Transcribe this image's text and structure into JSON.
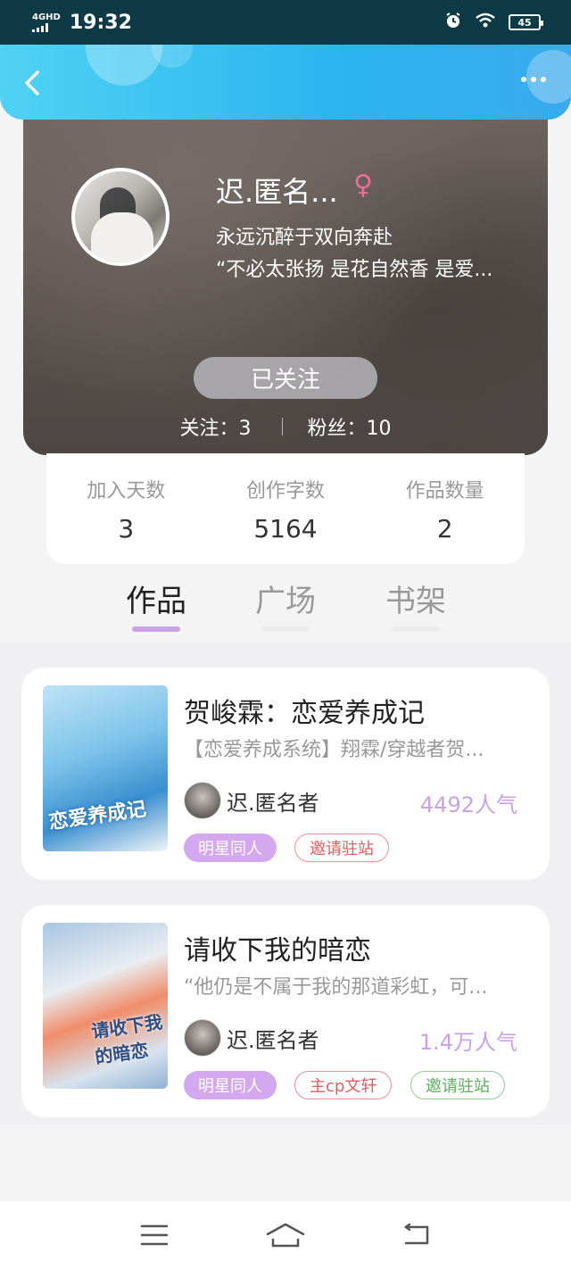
{
  "status_bar": {
    "network": "4GHD",
    "time": "19:32",
    "battery": "45"
  },
  "header": {
    "back_icon": "back-chevron-icon",
    "more_icon": "more-dots-icon"
  },
  "profile": {
    "name": "迟.匿名...",
    "gender_symbol": "♀",
    "bio_line1": "永远沉醉于双向奔赴",
    "bio_line2": "“不必太张扬 是花自然香 是爱...",
    "follow_button": "已关注",
    "following": "关注：3",
    "followers": "粉丝：10"
  },
  "stats": [
    {
      "label": "加入天数",
      "value": "3"
    },
    {
      "label": "创作字数",
      "value": "5164"
    },
    {
      "label": "作品数量",
      "value": "2"
    }
  ],
  "tabs": [
    {
      "label": "作品",
      "active": true
    },
    {
      "label": "广场",
      "active": false
    },
    {
      "label": "书架",
      "active": false
    }
  ],
  "works": [
    {
      "title": "贺峻霖：恋爱养成记",
      "description": "【恋爱养成系统】翔霖/穿越者贺...",
      "cover_text": "恋爱养成记",
      "author": "迟.匿名者",
      "popularity": "4492人气",
      "tags": [
        {
          "text": "明星同人",
          "style": "purple"
        },
        {
          "text": "邀请驻站",
          "style": "red"
        }
      ]
    },
    {
      "title": "请收下我的暗恋",
      "description": "“他仍是不属于我的那道彩虹，可...",
      "cover_text": "请收下我的暗恋",
      "author": "迟.匿名者",
      "popularity": "1.4万人气",
      "tags": [
        {
          "text": "明星同人",
          "style": "purple"
        },
        {
          "text": "主cp文轩",
          "style": "red"
        },
        {
          "text": "邀请驻站",
          "style": "green"
        }
      ]
    }
  ],
  "colors": {
    "header_blue": "#2bb5ef",
    "tab_indicator": "#c9a3e6",
    "popularity": "#c9a3e6",
    "tag_purple": "#d3a8ef",
    "gender_pink": "#f06c9b"
  },
  "nav_bar": {
    "menu_icon": "menu-icon",
    "home_icon": "home-icon",
    "back_icon": "return-icon"
  }
}
